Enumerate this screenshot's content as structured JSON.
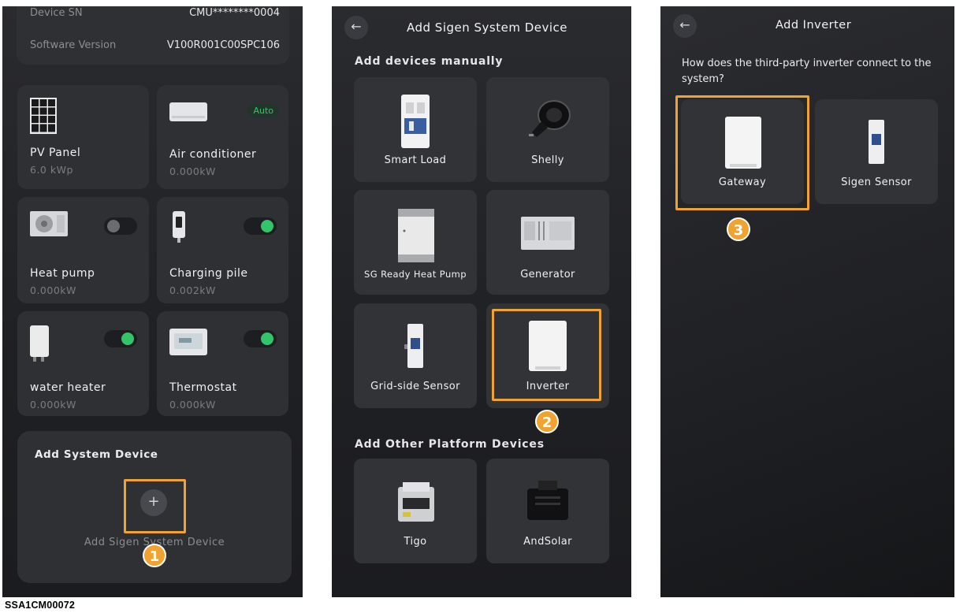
{
  "screen1": {
    "info": {
      "rows": [
        {
          "label": "Device SN",
          "value": "CMU********0004"
        },
        {
          "label": "Software Version",
          "value": "V100R001C00SPC106"
        }
      ]
    },
    "devices": [
      {
        "name": "PV Panel",
        "value": "6.0 kWp",
        "icon": "pv-panel-icon",
        "control": "none"
      },
      {
        "name": "Air conditioner",
        "value": "0.000kW",
        "icon": "air-conditioner-icon",
        "control": "auto",
        "badge": "Auto"
      },
      {
        "name": "Heat pump",
        "value": "0.000kW",
        "icon": "heat-pump-icon",
        "control": "toggle",
        "on": false
      },
      {
        "name": "Charging pile",
        "value": "0.002kW",
        "icon": "charging-pile-icon",
        "control": "toggle",
        "on": true
      },
      {
        "name": "water heater",
        "value": "0.000kW",
        "icon": "water-heater-icon",
        "control": "toggle",
        "on": true
      },
      {
        "name": "Thermostat",
        "value": "0.000kW",
        "icon": "thermostat-icon",
        "control": "toggle",
        "on": true
      }
    ],
    "add_section_title": "Add System Device",
    "add_button_symbol": "+",
    "add_button_label": "Add Sigen System Device",
    "step": "1"
  },
  "screen2": {
    "title": "Add Sigen System Device",
    "manual_title": "Add devices manually",
    "manual_devices": [
      "Smart Load",
      "Shelly",
      "SG Ready Heat Pump",
      "Generator",
      "Grid-side Sensor",
      "Inverter"
    ],
    "other_title": "Add Other Platform Devices",
    "other_devices": [
      "Tigo",
      "AndSolar"
    ],
    "step": "2"
  },
  "screen3": {
    "title": "Add Inverter",
    "question": "How does the third-party inverter connect to the system?",
    "options": [
      "Gateway",
      "Sigen Sensor"
    ],
    "step": "3"
  },
  "caption": "SSA1CM00072",
  "colors": {
    "highlight": "#f0a330",
    "toggle_on": "#33c46a",
    "background": "#1f2023"
  }
}
